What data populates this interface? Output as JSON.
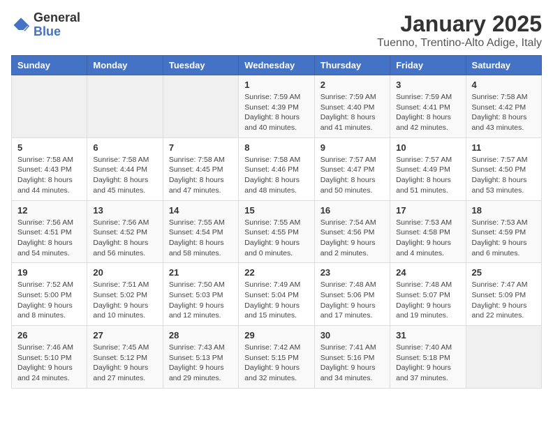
{
  "logo": {
    "general": "General",
    "blue": "Blue"
  },
  "title": "January 2025",
  "location": "Tuenno, Trentino-Alto Adige, Italy",
  "days_of_week": [
    "Sunday",
    "Monday",
    "Tuesday",
    "Wednesday",
    "Thursday",
    "Friday",
    "Saturday"
  ],
  "weeks": [
    [
      {
        "day": "",
        "info": ""
      },
      {
        "day": "",
        "info": ""
      },
      {
        "day": "",
        "info": ""
      },
      {
        "day": "1",
        "info": "Sunrise: 7:59 AM\nSunset: 4:39 PM\nDaylight: 8 hours\nand 40 minutes."
      },
      {
        "day": "2",
        "info": "Sunrise: 7:59 AM\nSunset: 4:40 PM\nDaylight: 8 hours\nand 41 minutes."
      },
      {
        "day": "3",
        "info": "Sunrise: 7:59 AM\nSunset: 4:41 PM\nDaylight: 8 hours\nand 42 minutes."
      },
      {
        "day": "4",
        "info": "Sunrise: 7:58 AM\nSunset: 4:42 PM\nDaylight: 8 hours\nand 43 minutes."
      }
    ],
    [
      {
        "day": "5",
        "info": "Sunrise: 7:58 AM\nSunset: 4:43 PM\nDaylight: 8 hours\nand 44 minutes."
      },
      {
        "day": "6",
        "info": "Sunrise: 7:58 AM\nSunset: 4:44 PM\nDaylight: 8 hours\nand 45 minutes."
      },
      {
        "day": "7",
        "info": "Sunrise: 7:58 AM\nSunset: 4:45 PM\nDaylight: 8 hours\nand 47 minutes."
      },
      {
        "day": "8",
        "info": "Sunrise: 7:58 AM\nSunset: 4:46 PM\nDaylight: 8 hours\nand 48 minutes."
      },
      {
        "day": "9",
        "info": "Sunrise: 7:57 AM\nSunset: 4:47 PM\nDaylight: 8 hours\nand 50 minutes."
      },
      {
        "day": "10",
        "info": "Sunrise: 7:57 AM\nSunset: 4:49 PM\nDaylight: 8 hours\nand 51 minutes."
      },
      {
        "day": "11",
        "info": "Sunrise: 7:57 AM\nSunset: 4:50 PM\nDaylight: 8 hours\nand 53 minutes."
      }
    ],
    [
      {
        "day": "12",
        "info": "Sunrise: 7:56 AM\nSunset: 4:51 PM\nDaylight: 8 hours\nand 54 minutes."
      },
      {
        "day": "13",
        "info": "Sunrise: 7:56 AM\nSunset: 4:52 PM\nDaylight: 8 hours\nand 56 minutes."
      },
      {
        "day": "14",
        "info": "Sunrise: 7:55 AM\nSunset: 4:54 PM\nDaylight: 8 hours\nand 58 minutes."
      },
      {
        "day": "15",
        "info": "Sunrise: 7:55 AM\nSunset: 4:55 PM\nDaylight: 9 hours\nand 0 minutes."
      },
      {
        "day": "16",
        "info": "Sunrise: 7:54 AM\nSunset: 4:56 PM\nDaylight: 9 hours\nand 2 minutes."
      },
      {
        "day": "17",
        "info": "Sunrise: 7:53 AM\nSunset: 4:58 PM\nDaylight: 9 hours\nand 4 minutes."
      },
      {
        "day": "18",
        "info": "Sunrise: 7:53 AM\nSunset: 4:59 PM\nDaylight: 9 hours\nand 6 minutes."
      }
    ],
    [
      {
        "day": "19",
        "info": "Sunrise: 7:52 AM\nSunset: 5:00 PM\nDaylight: 9 hours\nand 8 minutes."
      },
      {
        "day": "20",
        "info": "Sunrise: 7:51 AM\nSunset: 5:02 PM\nDaylight: 9 hours\nand 10 minutes."
      },
      {
        "day": "21",
        "info": "Sunrise: 7:50 AM\nSunset: 5:03 PM\nDaylight: 9 hours\nand 12 minutes."
      },
      {
        "day": "22",
        "info": "Sunrise: 7:49 AM\nSunset: 5:04 PM\nDaylight: 9 hours\nand 15 minutes."
      },
      {
        "day": "23",
        "info": "Sunrise: 7:48 AM\nSunset: 5:06 PM\nDaylight: 9 hours\nand 17 minutes."
      },
      {
        "day": "24",
        "info": "Sunrise: 7:48 AM\nSunset: 5:07 PM\nDaylight: 9 hours\nand 19 minutes."
      },
      {
        "day": "25",
        "info": "Sunrise: 7:47 AM\nSunset: 5:09 PM\nDaylight: 9 hours\nand 22 minutes."
      }
    ],
    [
      {
        "day": "26",
        "info": "Sunrise: 7:46 AM\nSunset: 5:10 PM\nDaylight: 9 hours\nand 24 minutes."
      },
      {
        "day": "27",
        "info": "Sunrise: 7:45 AM\nSunset: 5:12 PM\nDaylight: 9 hours\nand 27 minutes."
      },
      {
        "day": "28",
        "info": "Sunrise: 7:43 AM\nSunset: 5:13 PM\nDaylight: 9 hours\nand 29 minutes."
      },
      {
        "day": "29",
        "info": "Sunrise: 7:42 AM\nSunset: 5:15 PM\nDaylight: 9 hours\nand 32 minutes."
      },
      {
        "day": "30",
        "info": "Sunrise: 7:41 AM\nSunset: 5:16 PM\nDaylight: 9 hours\nand 34 minutes."
      },
      {
        "day": "31",
        "info": "Sunrise: 7:40 AM\nSunset: 5:18 PM\nDaylight: 9 hours\nand 37 minutes."
      },
      {
        "day": "",
        "info": ""
      }
    ]
  ]
}
